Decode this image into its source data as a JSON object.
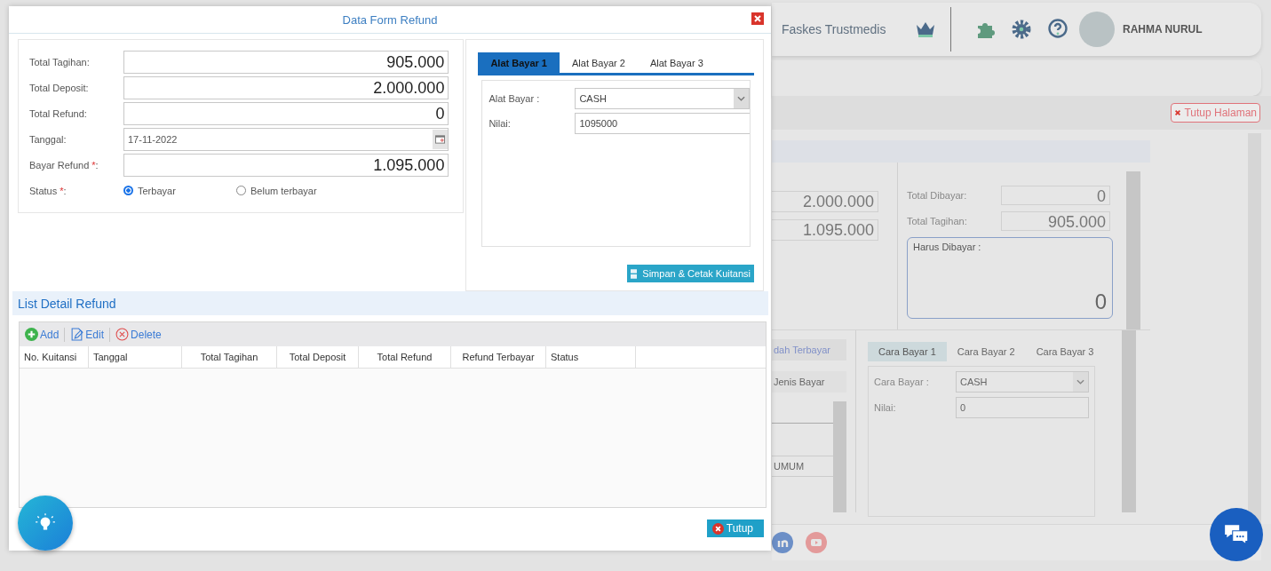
{
  "modal": {
    "title": "Data Form Refund",
    "fields": [
      {
        "label": "Total Tagihan:",
        "value": "905.000",
        "kind": "amount"
      },
      {
        "label": "Total Deposit:",
        "value": "2.000.000",
        "kind": "amount"
      },
      {
        "label": "Total Refund:",
        "value": "0",
        "kind": "amount"
      },
      {
        "label": "Tanggal:",
        "value": "17-11-2022",
        "kind": "date"
      },
      {
        "label": "Bayar Refund ",
        "required_mark": "*",
        "label_end": ":",
        "value": "1.095.000",
        "kind": "amount"
      }
    ],
    "status": {
      "label": "Status ",
      "required_mark": "*",
      "label_end": ":",
      "options": [
        {
          "label": "Terbayar",
          "selected": true
        },
        {
          "label": "Belum terbayar",
          "selected": false
        }
      ]
    },
    "payment_tabs": [
      {
        "label": "Alat Bayar 1",
        "selected": true
      },
      {
        "label": "Alat Bayar 2",
        "selected": false
      },
      {
        "label": "Alat Bayar 3",
        "selected": false
      }
    ],
    "payment": {
      "method_label": "Alat Bayar :",
      "method": "CASH",
      "value_label": "Nilai:",
      "value": "1095000"
    },
    "save_button": "Simpan & Cetak Kuitansi",
    "list": {
      "title": "List Detail Refund",
      "toolbar": [
        {
          "label": "Add",
          "kind": "add"
        },
        {
          "label": "Edit",
          "kind": "edit"
        },
        {
          "label": "Delete",
          "kind": "delete"
        }
      ],
      "columns": [
        "No. Kuitansi",
        "Tanggal",
        "Total Tagihan",
        "Total Deposit",
        "Total Refund",
        "Refund Terbayar",
        "Status"
      ]
    },
    "close_button": "Tutup"
  },
  "background": {
    "facility": "Faskes Trustmedis",
    "user": "RAHMA NURUL",
    "close_page_button": "Tutup Halaman",
    "summary_values": [
      "2.000.000",
      "1.095.000"
    ],
    "totals": [
      {
        "label": "Total Dibayar:",
        "value": "0"
      },
      {
        "label": "Total Tagihan:",
        "value": "905.000"
      }
    ],
    "due": {
      "label": "Harus Dibayar :",
      "value": "0"
    },
    "history_tab": "dah Terbayar",
    "history_column": "Jenis Bayar",
    "history_row": "UMUM",
    "pay_tabs": [
      {
        "label": "Cara Bayar 1",
        "selected": true
      },
      {
        "label": "Cara Bayar 2",
        "selected": false
      },
      {
        "label": "Cara Bayar 3",
        "selected": false
      }
    ],
    "pay": {
      "method_label": "Cara Bayar :",
      "method": "CASH",
      "value_label": "Nilai:",
      "value": "0"
    }
  }
}
